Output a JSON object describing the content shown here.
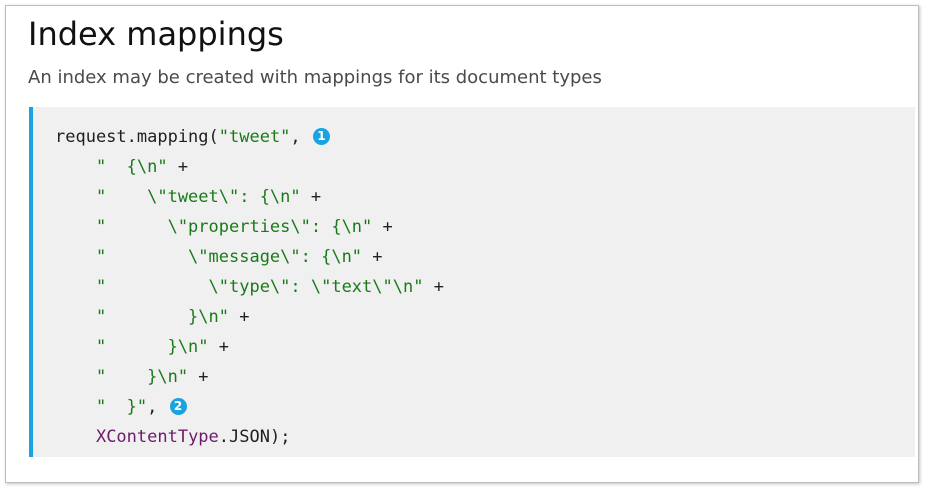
{
  "header": {
    "title": "Index mappings",
    "subtitle": "An index may be created with mappings for its document types"
  },
  "code": {
    "lines": [
      {
        "parts": [
          {
            "t": "ident",
            "v": "request.mapping("
          },
          {
            "t": "str",
            "v": "\"tweet\""
          },
          {
            "t": "op",
            "v": ", "
          }
        ],
        "callout": "1"
      },
      {
        "parts": [
          {
            "t": "str",
            "v": "    \"  {\\n\""
          },
          {
            "t": "op",
            "v": " +"
          }
        ]
      },
      {
        "parts": [
          {
            "t": "str",
            "v": "    \"    \\\"tweet\\\": {\\n\""
          },
          {
            "t": "op",
            "v": " +"
          }
        ]
      },
      {
        "parts": [
          {
            "t": "str",
            "v": "    \"      \\\"properties\\\": {\\n\""
          },
          {
            "t": "op",
            "v": " +"
          }
        ]
      },
      {
        "parts": [
          {
            "t": "str",
            "v": "    \"        \\\"message\\\": {\\n\""
          },
          {
            "t": "op",
            "v": " +"
          }
        ]
      },
      {
        "parts": [
          {
            "t": "str",
            "v": "    \"          \\\"type\\\": \\\"text\\\"\\n\""
          },
          {
            "t": "op",
            "v": " +"
          }
        ]
      },
      {
        "parts": [
          {
            "t": "str",
            "v": "    \"        }\\n\""
          },
          {
            "t": "op",
            "v": " +"
          }
        ]
      },
      {
        "parts": [
          {
            "t": "str",
            "v": "    \"      }\\n\""
          },
          {
            "t": "op",
            "v": " +"
          }
        ]
      },
      {
        "parts": [
          {
            "t": "str",
            "v": "    \"    }\\n\""
          },
          {
            "t": "op",
            "v": " +"
          }
        ]
      },
      {
        "parts": [
          {
            "t": "str",
            "v": "    \"  }\""
          },
          {
            "t": "op",
            "v": ", "
          }
        ],
        "callout": "2"
      },
      {
        "parts": [
          {
            "t": "op",
            "v": "    "
          },
          {
            "t": "class",
            "v": "XContentType"
          },
          {
            "t": "ident",
            "v": ".JSON);"
          }
        ]
      }
    ]
  },
  "colors": {
    "accent": "#1aa3e0",
    "code_background": "#f0f0f0",
    "string": "#1a7a1a",
    "class_name": "#6a1b6a"
  }
}
